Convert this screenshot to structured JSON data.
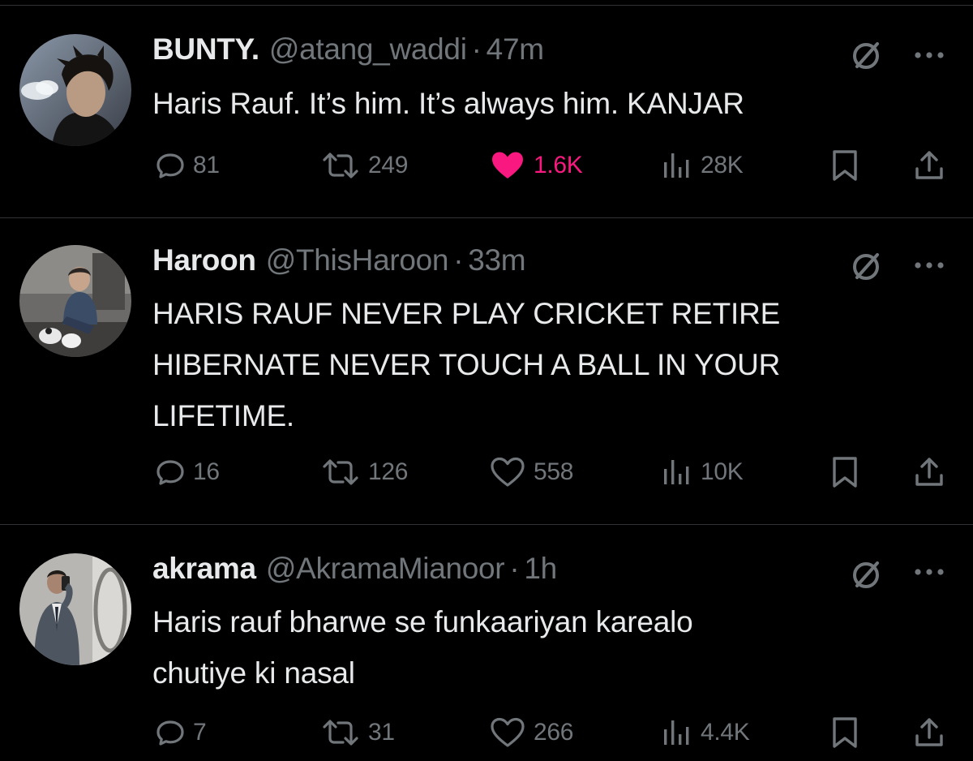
{
  "colors": {
    "background": "#000000",
    "text_primary": "#e7e9ea",
    "text_secondary": "#71767b",
    "divider": "#2f3336",
    "like_active": "#f91880"
  },
  "tweets": [
    {
      "display_name": "BUNTY.",
      "handle": "@atang_waddi",
      "separator": "·",
      "time": "47m",
      "text": "Haris Rauf. It’s him. It’s always him. KANJAR",
      "replies": "81",
      "retweets": "249",
      "likes": "1.6K",
      "liked": true,
      "views": "28K"
    },
    {
      "display_name": "Haroon",
      "handle": "@ThisHaroon",
      "separator": "·",
      "time": "33m",
      "text": "HARIS RAUF NEVER PLAY CRICKET RETIRE\nHIBERNATE NEVER TOUCH A BALL IN YOUR\nLIFETIME.",
      "replies": "16",
      "retweets": "126",
      "likes": "558",
      "liked": false,
      "views": "10K"
    },
    {
      "display_name": "akrama",
      "handle": "@AkramaMianoor",
      "separator": "·",
      "time": "1h",
      "text": "Haris rauf bharwe se funkaariyan karealo\nchutiye ki nasal",
      "replies": "7",
      "retweets": "31",
      "likes": "266",
      "liked": false,
      "views": "4.4K"
    }
  ],
  "icons": {
    "reply": "reply-bubble-icon",
    "retweet": "retweet-arrows-icon",
    "like": "heart-icon",
    "views": "views-bar-chart-icon",
    "bookmark": "bookmark-icon",
    "share": "share-upload-icon",
    "grok": "grok-slash-circle-icon",
    "more": "more-dots-icon"
  }
}
